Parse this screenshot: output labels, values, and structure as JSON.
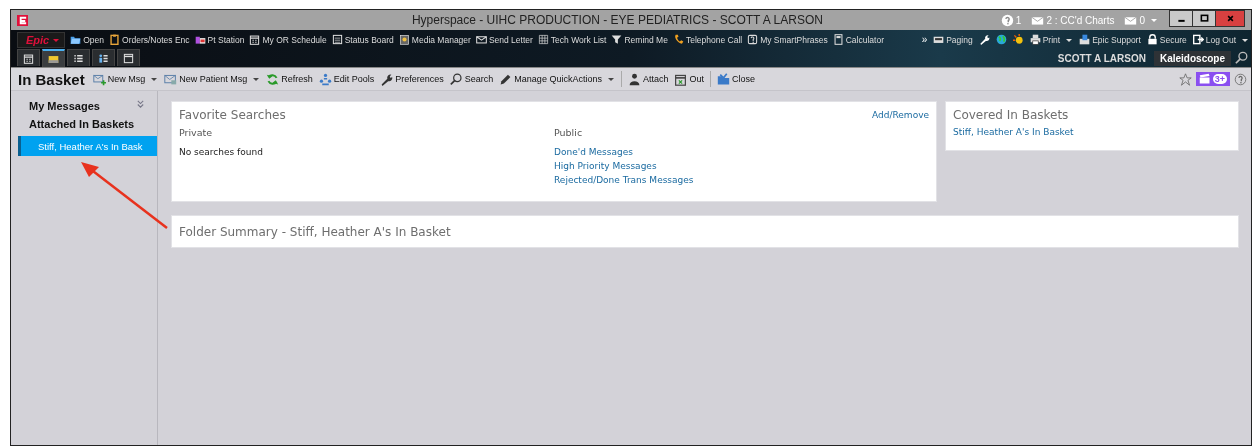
{
  "window": {
    "title": "Hyperspace - UIHC PRODUCTION - EYE PEDIATRICS - SCOTT A LARSON"
  },
  "title_bar_status": [
    {
      "kind": "help",
      "text": "1"
    },
    {
      "kind": "mail",
      "text": "2 : CC'd Charts"
    },
    {
      "kind": "mail-menu",
      "text": "0"
    }
  ],
  "epic_menu": {
    "label": "Epic"
  },
  "toolbar": {
    "items": [
      "Open",
      "Orders/Notes Enc",
      "Pt Station",
      "My OR Schedule",
      "Status Board",
      "Media Manager",
      "Send Letter",
      "Tech Work List",
      "Remind Me",
      "Telephone Call",
      "My SmartPhrases",
      "Calculator"
    ],
    "overflow": "»",
    "right_items": [
      {
        "label": "Paging",
        "menu": false
      },
      {
        "label": "Print",
        "menu": true
      },
      {
        "label": "Epic Support",
        "menu": false
      },
      {
        "label": "Secure",
        "menu": false
      },
      {
        "label": "Log Out",
        "menu": true
      }
    ]
  },
  "workspace_tabs": [
    {
      "selected": false
    },
    {
      "selected": true
    },
    {
      "selected": false
    },
    {
      "selected": false
    },
    {
      "selected": false
    }
  ],
  "user": {
    "name": "SCOTT A LARSON",
    "context": "Kaleidoscope"
  },
  "activity": {
    "title": "In Basket",
    "actions": [
      {
        "kind": "button",
        "label": "New Msg",
        "menu": true
      },
      {
        "kind": "button",
        "label": "New Patient Msg",
        "menu": true
      },
      {
        "kind": "button",
        "label": "Refresh",
        "menu": false
      },
      {
        "kind": "button",
        "label": "Edit Pools",
        "menu": false
      },
      {
        "kind": "button",
        "label": "Preferences",
        "menu": false
      },
      {
        "kind": "button",
        "label": "Search",
        "menu": false
      },
      {
        "kind": "button",
        "label": "Manage QuickActions",
        "menu": true
      },
      {
        "kind": "divider"
      },
      {
        "kind": "button",
        "label": "Attach",
        "menu": false
      },
      {
        "kind": "button",
        "label": "Out",
        "menu": false
      },
      {
        "kind": "divider"
      },
      {
        "kind": "button",
        "label": "Close",
        "menu": false
      }
    ],
    "badge": "3+"
  },
  "sidebar": {
    "sections": [
      {
        "title": "My Messages"
      },
      {
        "title": "Attached In Baskets",
        "items": [
          {
            "label": "Stiff, Heather A's In Bask",
            "selected": true
          }
        ]
      }
    ]
  },
  "favorite_searches": {
    "title": "Favorite Searches",
    "action": "Add/Remove",
    "private": {
      "heading": "Private",
      "items": [
        "No searches found"
      ]
    },
    "public": {
      "heading": "Public",
      "links": [
        "Done'd Messages",
        "High Priority Messages",
        "Rejected/Done Trans Messages"
      ]
    }
  },
  "covered_in_baskets": {
    "title": "Covered In Baskets",
    "links": [
      "Stiff, Heather A's In Basket"
    ]
  },
  "folder_summary": {
    "title": "Folder Summary - Stiff, Heather A's In Basket"
  }
}
